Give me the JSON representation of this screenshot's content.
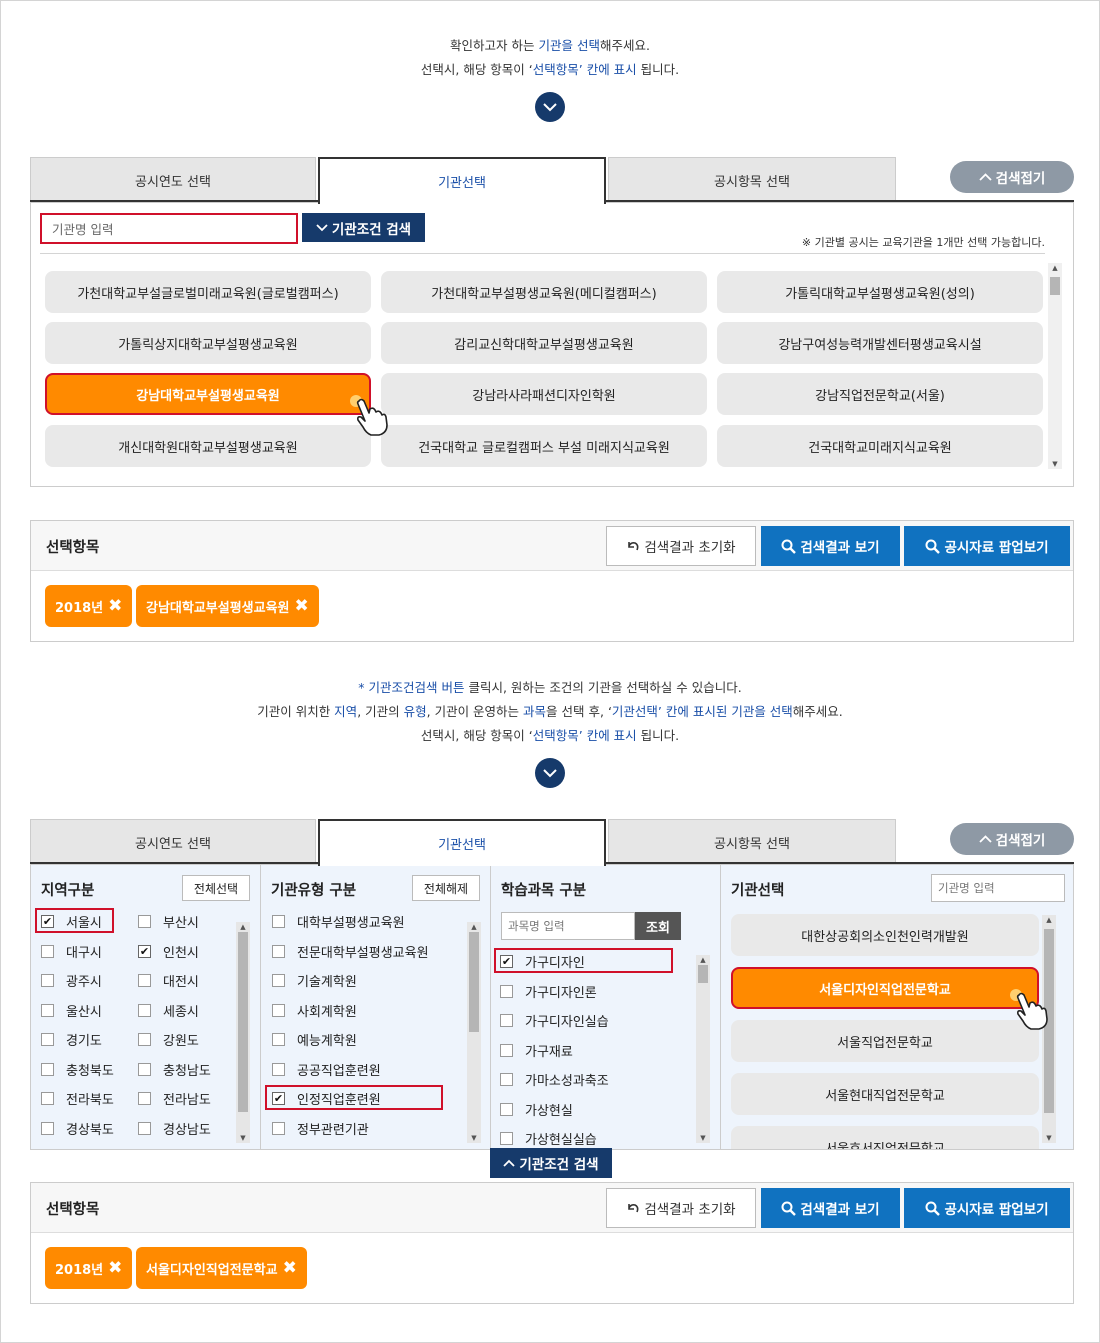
{
  "section1": {
    "guide_line1_a": "확인하고자 하는 ",
    "guide_line1_b": "기관을 선택",
    "guide_line1_c": "해주세요.",
    "guide_line2_a": "선택시, 해당 항목이 ‘",
    "guide_line2_b": "선택항목’ 칸에 표시",
    "guide_line2_c": " 됩니다.",
    "tabs": [
      "공시연도 선택",
      "기관선택",
      "공시항목 선택"
    ],
    "collapse_label": "검색접기",
    "search_placeholder": "기관명 입력",
    "condition_search_label": "기관조건 검색",
    "note": "※ 기관별 공시는 교육기관을 1개만 선택 가능합니다.",
    "institutions": [
      "가천대학교부설글로벌미래교육원(글로벌캠퍼스)",
      "가천대학교부설평생교육원(메디컬캠퍼스)",
      "가톨릭대학교부설평생교육원(성의)",
      "가톨릭상지대학교부설평생교육원",
      "감리교신학대학교부설평생교육원",
      "강남구여성능력개발센터평생교육시설",
      "강남대학교부설평생교육원",
      "강남라사라패션디자인학원",
      "강남직업전문학교(서울)",
      "개신대학원대학교부설평생교육원",
      "건국대학교 글로컬캠퍼스 부설 미래지식교육원",
      "건국대학교미래지식교육원"
    ],
    "selected_index": 6
  },
  "selection1": {
    "title": "선택항목",
    "reset_label": "검색결과 초기화",
    "view_label": "검색결과 보기",
    "popup_label": "공시자료 팝업보기",
    "chips": [
      "2018년",
      "강남대학교부설평생교육원"
    ]
  },
  "section2": {
    "guide_line1_a": "* ",
    "guide_line1_b": "기관조건검색 버튼",
    "guide_line1_c": " 클릭시, 원하는 조건의 기관을 선택하실 수 있습니다.",
    "guide_line2_a": "기관이 위치한 ",
    "guide_line2_b": "지역",
    "guide_line2_c": ", 기관의 ",
    "guide_line2_d": "유형",
    "guide_line2_e": ", 기관이 운영하는 ",
    "guide_line2_f": "과목",
    "guide_line2_g": "을 선택 후, ‘",
    "guide_line2_h": "기관선택’ 칸에 표시된 기관을 선택",
    "guide_line2_i": "해주세요.",
    "guide_line3_a": "선택시, 해당 항목이 ‘",
    "guide_line3_b": "선택항목’ 칸에 표시",
    "guide_line3_c": " 됩니다.",
    "tabs": [
      "공시연도 선택",
      "기관선택",
      "공시항목 선택"
    ],
    "collapse_label": "검색접기",
    "region": {
      "title": "지역구분",
      "btn": "전체선택",
      "items": [
        {
          "label": "서울시",
          "checked": true
        },
        {
          "label": "부산시",
          "checked": false
        },
        {
          "label": "대구시",
          "checked": false
        },
        {
          "label": "인천시",
          "checked": true
        },
        {
          "label": "광주시",
          "checked": false
        },
        {
          "label": "대전시",
          "checked": false
        },
        {
          "label": "울산시",
          "checked": false
        },
        {
          "label": "세종시",
          "checked": false
        },
        {
          "label": "경기도",
          "checked": false
        },
        {
          "label": "강원도",
          "checked": false
        },
        {
          "label": "충청북도",
          "checked": false
        },
        {
          "label": "충청남도",
          "checked": false
        },
        {
          "label": "전라북도",
          "checked": false
        },
        {
          "label": "전라남도",
          "checked": false
        },
        {
          "label": "경상북도",
          "checked": false
        },
        {
          "label": "경상남도",
          "checked": false
        }
      ]
    },
    "type": {
      "title": "기관유형 구분",
      "btn": "전체해제",
      "items": [
        {
          "label": "대학부설평생교육원",
          "checked": false
        },
        {
          "label": "전문대학부설평생교육원",
          "checked": false
        },
        {
          "label": "기술계학원",
          "checked": false
        },
        {
          "label": "사회계학원",
          "checked": false
        },
        {
          "label": "예능계학원",
          "checked": false
        },
        {
          "label": "공공직업훈련원",
          "checked": false
        },
        {
          "label": "인정직업훈련원",
          "checked": true
        },
        {
          "label": "정부관련기관",
          "checked": false
        }
      ]
    },
    "subject": {
      "title": "학습과목 구분",
      "placeholder": "과목명 입력",
      "btn": "조회",
      "items": [
        {
          "label": "가구디자인",
          "checked": true
        },
        {
          "label": "가구디자인론",
          "checked": false
        },
        {
          "label": "가구디자인실습",
          "checked": false
        },
        {
          "label": "가구재료",
          "checked": false
        },
        {
          "label": "가마소성과축조",
          "checked": false
        },
        {
          "label": "가상현실",
          "checked": false
        },
        {
          "label": "가상현실실습",
          "checked": false
        }
      ]
    },
    "inst": {
      "title": "기관선택",
      "placeholder": "기관명 입력",
      "items": [
        "대한상공회의소인천인력개발원",
        "서울디자인직업전문학교",
        "서울직업전문학교",
        "서울현대직업전문학교",
        "서울호서직업전문학교"
      ],
      "selected_index": 1
    },
    "condition_search_label": "기관조건 검색"
  },
  "selection2": {
    "title": "선택항목",
    "reset_label": "검색결과 초기화",
    "view_label": "검색결과 보기",
    "popup_label": "공시자료 팝업보기",
    "chips": [
      "2018년",
      "서울디자인직업전문학교"
    ]
  }
}
